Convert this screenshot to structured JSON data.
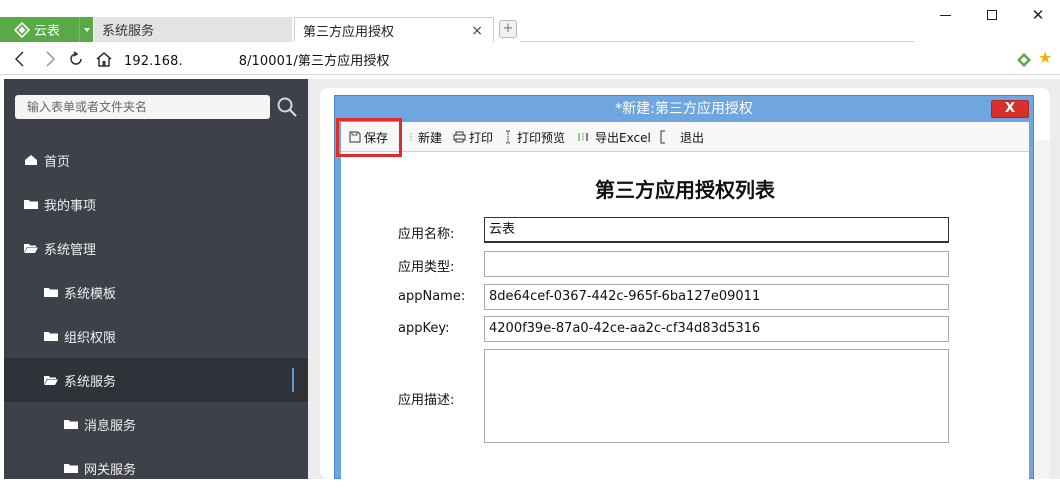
{
  "browser": {
    "app_tab": "云表",
    "tabs": [
      {
        "label": "系统服务",
        "active": false
      },
      {
        "label": "第三方应用授权",
        "active": true,
        "close": "×"
      }
    ],
    "new_tab_symbol": "+",
    "window_close": "✕",
    "url_host": "192.168.",
    "url_path": "8/10001/第三方应用授权"
  },
  "sidebar": {
    "search_placeholder": "输入表单或者文件夹名",
    "items": [
      {
        "label": "首页",
        "icon": "home-icon",
        "level": 0
      },
      {
        "label": "我的事项",
        "icon": "folder-icon",
        "level": 0
      },
      {
        "label": "系统管理",
        "icon": "folder-open-icon",
        "level": 0
      },
      {
        "label": "系统模板",
        "icon": "folder-icon",
        "level": 1
      },
      {
        "label": "组织权限",
        "icon": "folder-icon",
        "level": 1
      },
      {
        "label": "系统服务",
        "icon": "folder-open-icon",
        "level": 1,
        "active": true
      },
      {
        "label": "消息服务",
        "icon": "folder-icon",
        "level": 2
      },
      {
        "label": "网关服务",
        "icon": "folder-icon",
        "level": 2
      }
    ]
  },
  "dialog": {
    "title": "*新建:第三方应用授权",
    "close_label": "X",
    "toolbar": {
      "save": "保存",
      "new": "新建",
      "print": "打印",
      "print_preview": "打印预览",
      "export_excel": "导出Excel",
      "exit": "退出"
    },
    "form_title": "第三方应用授权列表",
    "fields": {
      "app_name_label": "应用名称:",
      "app_name_value": "云表",
      "app_type_label": "应用类型:",
      "app_type_value": "",
      "appname_label": "appName:",
      "appname_value": "8de64cef-0367-442c-965f-6ba127e09011",
      "appkey_label": "appKey:",
      "appkey_value": "4200f39e-87a0-42ce-aa2c-cf34d83d5316",
      "desc_label": "应用描述:",
      "desc_value": ""
    }
  },
  "colors": {
    "app_green": "#5aa947",
    "sidebar_bg": "#3e4149",
    "dialog_blue": "#6ea6e0",
    "highlight_red": "#e32a2a"
  }
}
